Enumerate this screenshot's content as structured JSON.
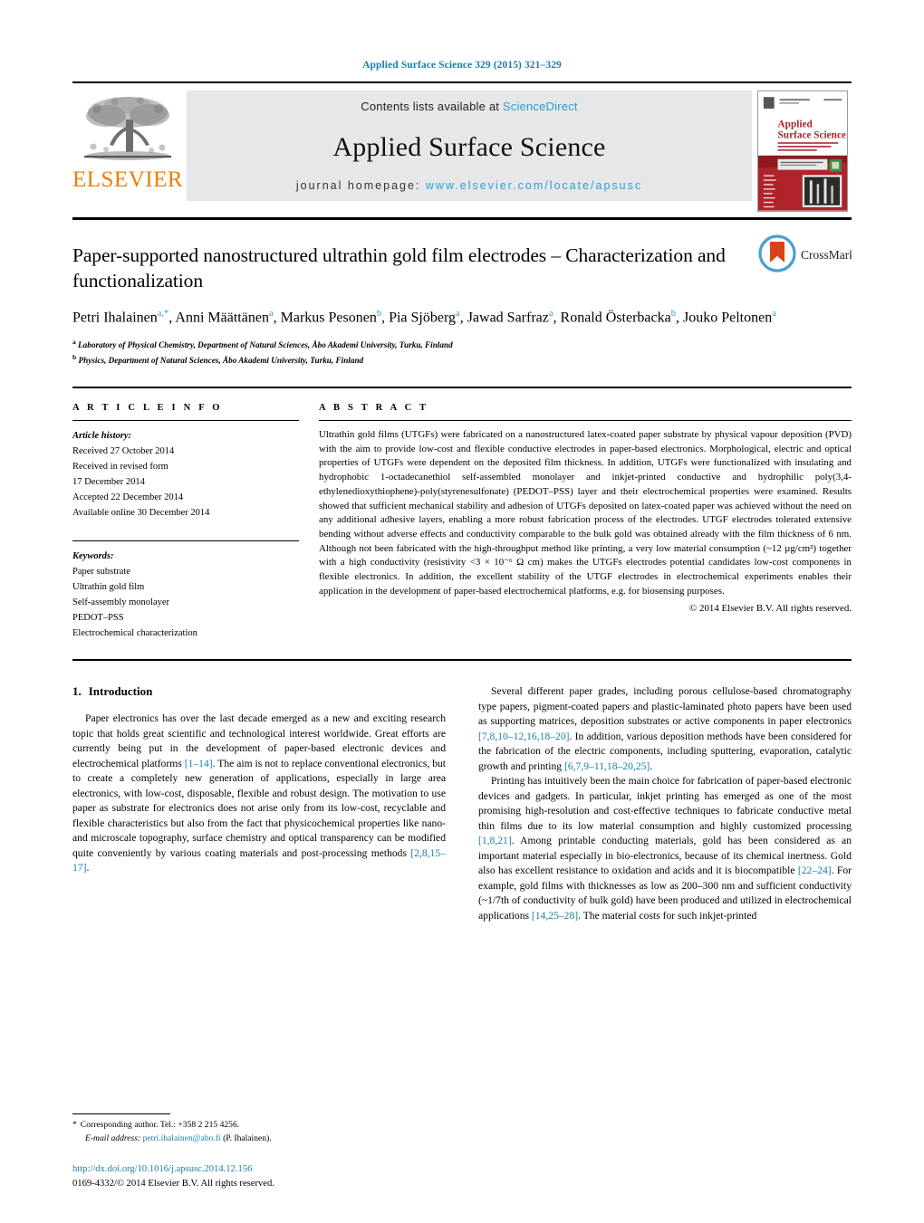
{
  "running_head": "Applied Surface Science 329 (2015) 321–329",
  "masthead": {
    "publisher_name": "ELSEVIER",
    "contents_prefix": "Contents lists available at ",
    "contents_link": "ScienceDirect",
    "journal_title": "Applied Surface Science",
    "homepage_prefix": "journal homepage: ",
    "homepage_url": "www.elsevier.com/locate/apsusc",
    "cover_title_line1": "Applied",
    "cover_title_line2": "Surface Science"
  },
  "crossmark": {
    "label": "CrossMark"
  },
  "article": {
    "title": "Paper-supported nanostructured ultrathin gold film electrodes – Characterization and functionalization",
    "authors_html": "Petri Ihalainen<sup>a,*</sup>, Anni Määttänen<sup>a</sup>, Markus Pesonen<sup>b</sup>, Pia Sjöberg<sup>a</sup>, Jawad Sarfraz<sup>a</sup>, Ronald Österbacka<sup>b</sup>, Jouko Peltonen<sup>a</sup>",
    "affiliation_a": "Laboratory of Physical Chemistry, Department of Natural Sciences, Åbo Akademi University, Turku, Finland",
    "affiliation_b": "Physics, Department of Natural Sciences, Åbo Akademi University, Turku, Finland"
  },
  "article_info": {
    "heading": "A R T I C L E   I N F O",
    "history_label": "Article history:",
    "history": [
      "Received 27 October 2014",
      "Received in revised form",
      "17 December 2014",
      "Accepted 22 December 2014",
      "Available online 30 December 2014"
    ],
    "keywords_label": "Keywords:",
    "keywords": [
      "Paper substrate",
      "Ultrathin gold film",
      "Self-assembly monolayer",
      "PEDOT–PSS",
      "Electrochemical characterization"
    ]
  },
  "abstract": {
    "heading": "A B S T R A C T",
    "text": "Ultrathin gold films (UTGFs) were fabricated on a nanostructured latex-coated paper substrate by physical vapour deposition (PVD) with the aim to provide low-cost and flexible conductive electrodes in paper-based electronics. Morphological, electric and optical properties of UTGFs were dependent on the deposited film thickness. In addition, UTGFs were functionalized with insulating and hydrophobic 1-octadecanethiol self-assembled monolayer and inkjet-printed conductive and hydrophilic poly(3,4-ethylenedioxythiophene)-poly(styrenesulfonate) (PEDOT–PSS) layer and their electrochemical properties were examined. Results showed that sufficient mechanical stability and adhesion of UTGFs deposited on latex-coated paper was achieved without the need on any additional adhesive layers, enabling a more robust fabrication process of the electrodes. UTGF electrodes tolerated extensive bending without adverse effects and conductivity comparable to the bulk gold was obtained already with the film thickness of 6 nm. Although not been fabricated with the high-throughput method like printing, a very low material consumption (~12 µg/cm²) together with a high conductivity (resistivity <3 × 10⁻⁶ Ω cm) makes the UTGFs electrodes potential candidates low-cost components in flexible electronics. In addition, the excellent stability of the UTGF electrodes in electrochemical experiments enables their application in the development of paper-based electrochemical platforms, e.g. for biosensing purposes.",
    "copyright": "© 2014 Elsevier B.V. All rights reserved."
  },
  "introduction": {
    "number": "1.",
    "title": "Introduction",
    "paragraphs_left": [
      "Paper electronics has over the last decade emerged as a new and exciting research topic that holds great scientific and technological interest worldwide. Great efforts are currently being put in the development of paper-based electronic devices and electrochemical platforms [1–14]. The aim is not to replace conventional electronics, but to create a completely new generation of applications, especially in large area electronics, with low-cost, disposable, flexible and robust design. The motivation to use paper as substrate for electronics does not arise only from its low-cost, recyclable and flexible characteristics but also from the fact that physicochemical properties like nano- and microscale topography, surface chemistry and optical transparency can be modified quite conveniently by various coating materials and post-processing methods [2,8,15–17]."
    ],
    "paragraphs_right": [
      "Several different paper grades, including porous cellulose-based chromatography type papers, pigment-coated papers and plastic-laminated photo papers have been used as supporting matrices, deposition substrates or active components in paper electronics [7,8,10–12,16,18–20]. In addition, various deposition methods have been considered for the fabrication of the electric components, including sputtering, evaporation, catalytic growth and printing [6,7,9–11,18–20,25].",
      "Printing has intuitively been the main choice for fabrication of paper-based electronic devices and gadgets. In particular, inkjet printing has emerged as one of the most promising high-resolution and cost-effective techniques to fabricate conductive metal thin films due to its low material consumption and highly customized processing [1,8,21]. Among printable conducting materials, gold has been considered as an important material especially in bio-electronics, because of its chemical inertness. Gold also has excellent resistance to oxidation and acids and it is biocompatible [22–24]. For example, gold films with thicknesses as low as 200–300 nm and sufficient conductivity (~1/7th of conductivity of bulk gold) have been produced and utilized in electrochemical applications [14,25–28]. The material costs for such inkjet-printed"
    ]
  },
  "footnote": {
    "star": "*",
    "corresponding": "Corresponding author. Tel.: +358 2 215 4256.",
    "email_label": "E-mail address:",
    "email": "petri.ihalainen@abo.fi",
    "email_suffix": "(P. Ihalainen)."
  },
  "footer": {
    "doi": "http://dx.doi.org/10.1016/j.apsusc.2014.12.156",
    "issn": "0169-4332/© 2014 Elsevier B.V. All rights reserved."
  },
  "colors": {
    "link": "#1a7fa8",
    "sciencedirect": "#2a9fd6",
    "elsevier_orange": "#f07c00",
    "banner_bg": "#e6e7e8"
  }
}
